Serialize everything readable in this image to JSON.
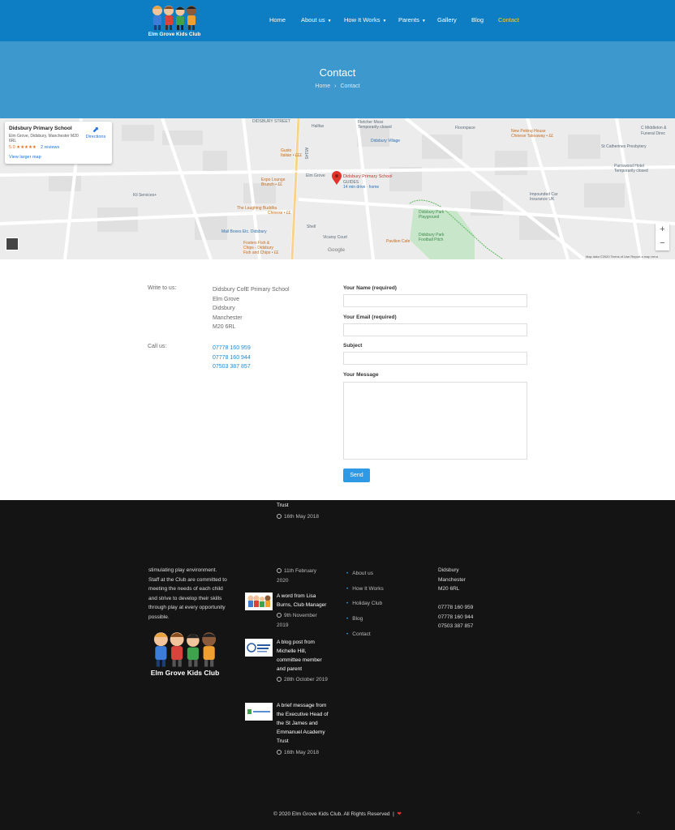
{
  "header": {
    "logo_text": "Elm Grove Kids Club",
    "nav": [
      {
        "label": "Home",
        "dropdown": false,
        "active": false
      },
      {
        "label": "About us",
        "dropdown": true,
        "active": false
      },
      {
        "label": "How It Works",
        "dropdown": true,
        "active": false
      },
      {
        "label": "Parents",
        "dropdown": true,
        "active": false
      },
      {
        "label": "Gallery",
        "dropdown": false,
        "active": false
      },
      {
        "label": "Blog",
        "dropdown": false,
        "active": false
      },
      {
        "label": "Contact",
        "dropdown": false,
        "active": true
      }
    ],
    "active_color": "#f5d042",
    "bar_color": "#0d7ec4"
  },
  "title_band": {
    "title": "Contact",
    "breadcrumb": [
      "Home",
      "Contact"
    ],
    "breadcrumb_separator": "›",
    "color": "#3d98cd"
  },
  "map": {
    "info_card": {
      "name": "Didsbury Primary School",
      "address": "Elm Grove, Didsbury, Manchester M20 6RL",
      "rating": "5.0 ★★★★★",
      "reviews": "2 reviews",
      "view_larger": "View larger map",
      "directions": "Directions"
    },
    "labels": {
      "didsbury_street": "DIDSBURY STREET",
      "halifax": "Halifax",
      "fletcher_moss": "Fletcher Moss",
      "fletcher_moss_sub": "Temporarily closed",
      "floorspace": "Floorspace",
      "new_peking": "New Peking House",
      "new_peking_sub": "Chinese Takeaway • ££",
      "cm_middleton": "C Middleton &",
      "funeral": "Funeral Direc",
      "didsbury_village": "Didsbury Village",
      "st_catherines": "St Catherines Presbytery",
      "gusto": "Gusto",
      "gusto_sub": "Italian • £££",
      "parrswood": "Parrswood Hotel",
      "parrswood_sub": "Temporarily closed",
      "expo": "Expo Lounge",
      "expo_sub": "Brunch • ££",
      "school_pin": "Didsbury Primary School",
      "school_sub": "GUIDES",
      "school_sub2": "14 min drive · home",
      "kil_services": "Kil Services+",
      "impounded": "Impounded Car",
      "impounded2": "Insurance UK",
      "laughing_buddha": "The Laughing Buddha",
      "laughing_sub": "Chinese • ££",
      "park_playground": "Didsbury Park",
      "park_playground2": "Playground",
      "shell": "Shell",
      "mail_boxes": "Mail Boxes Etc. Didsbury",
      "didsbury_park": "Didsbury Park",
      "football": "Football Pitch",
      "vicarsy": "Vicarsy Court",
      "fosters": "Fosters Fish &",
      "fosters2": "Chips - Didsbury",
      "fosters_sub": "Fish and Chips • ££",
      "pavilion": "Pavilion Cafe",
      "a5145": "A5145",
      "elm_grove": "Elm Grove"
    },
    "google": "Google",
    "footer_text": "Map data ©2020   Terms of Use   Report a map error",
    "zoom_in": "+",
    "zoom_out": "−"
  },
  "contact": {
    "write_label": "Write to us:",
    "address_lines": [
      "Didsbury CofE Primary School",
      "Elm Grove",
      "Didsbury",
      "Manchester",
      "M20 6RL"
    ],
    "call_label": "Call us:",
    "phones": [
      "07778 160 959",
      "07778 160 944",
      "07503 387 857"
    ],
    "form": {
      "name_label": "Your Name (required)",
      "email_label": "Your Email (required)",
      "subject_label": "Subject",
      "message_label": "Your Message",
      "name_value": "",
      "email_value": "",
      "subject_value": "",
      "message_value": "",
      "send_label": "Send"
    },
    "accent_color": "#2e9ae6"
  },
  "footer": {
    "top_post_title": "Trust",
    "top_post_date": "16th May 2018",
    "about_text": [
      "stimulating play environment.",
      "Staff at the Club are committed to",
      "meeting the needs of each child",
      "and strive to develop their skills",
      "through play at every opportunity",
      "possible."
    ],
    "logo_text": "Elm Grove Kids Club",
    "posts_first_date": "11th February 2020",
    "posts": [
      {
        "title": "A word from Lisa Burns, Club Manager",
        "date": "9th November 2019"
      },
      {
        "title": "A blog post from Michelle Hill, committee member and parent",
        "date": "28th October 2019"
      },
      {
        "title": "A brief message from the Executive Head of the St James and Emmanuel Academy Trust",
        "date": "16th May 2018"
      }
    ],
    "links": [
      "About us",
      "How It Works",
      "Holiday Club",
      "Blog",
      "Contact"
    ],
    "contact_lines": [
      "Didsbury",
      "Manchester",
      "M20 6RL"
    ],
    "contact_phones": [
      "07778 160 959",
      "07778 160 944",
      "07503 387 857"
    ],
    "copyright": "© 2020 Elm Grove Kids Club. All Rights Reserved",
    "heart": "❤",
    "to_top": "^",
    "background": "#141414"
  }
}
